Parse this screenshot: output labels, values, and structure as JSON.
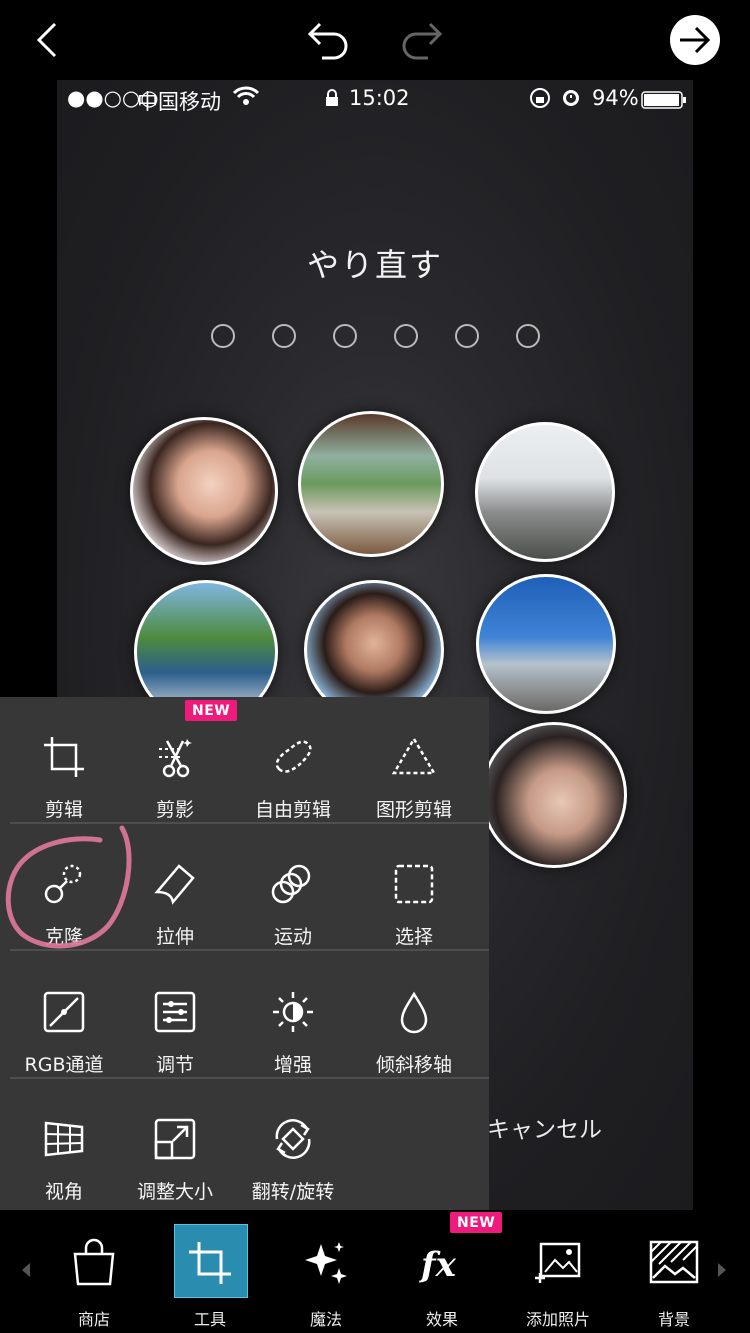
{
  "status_bar": {
    "signal": "●●○○○",
    "carrier": "中国移动",
    "time": "15:02",
    "battery": "94%"
  },
  "screen": {
    "title": "やり直す",
    "pin_dot_count": 6,
    "cancel": "キャンセル"
  },
  "tools_panel": {
    "new_badge": "NEW",
    "tools": [
      {
        "label": "剪辑",
        "icon": "crop-icon"
      },
      {
        "label": "剪影",
        "icon": "cutout-scissors-icon"
      },
      {
        "label": "自由剪辑",
        "icon": "free-crop-icon"
      },
      {
        "label": "图形剪辑",
        "icon": "shape-crop-icon"
      },
      {
        "label": "克隆",
        "icon": "clone-icon"
      },
      {
        "label": "拉伸",
        "icon": "stretch-icon"
      },
      {
        "label": "运动",
        "icon": "motion-icon"
      },
      {
        "label": "选择",
        "icon": "selection-icon"
      },
      {
        "label": "RGB通道",
        "icon": "curves-icon"
      },
      {
        "label": "调节",
        "icon": "adjust-icon"
      },
      {
        "label": "增强",
        "icon": "enhance-icon"
      },
      {
        "label": "倾斜移轴",
        "icon": "tilt-shift-icon"
      },
      {
        "label": "视角",
        "icon": "perspective-icon"
      },
      {
        "label": "调整大小",
        "icon": "resize-icon"
      },
      {
        "label": "翻转/旋转",
        "icon": "flip-rotate-icon"
      }
    ]
  },
  "bottom_nav": {
    "new_badge": "NEW",
    "items": [
      {
        "label": "商店",
        "icon": "shop-bag-icon"
      },
      {
        "label": "工具",
        "icon": "tools-crop-icon",
        "active": true
      },
      {
        "label": "魔法",
        "icon": "magic-sparkle-icon"
      },
      {
        "label": "效果",
        "icon": "fx-icon"
      },
      {
        "label": "添加照片",
        "icon": "add-photo-icon"
      },
      {
        "label": "背景",
        "icon": "background-icon"
      }
    ]
  },
  "colors": {
    "panel_bg": "#373737",
    "badge": "#f01a7c",
    "active_tab": "#2a8db0",
    "annotation_circle": "#e07a9a"
  }
}
